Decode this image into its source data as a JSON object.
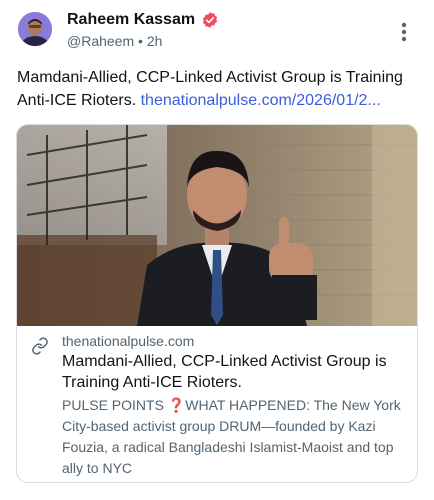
{
  "post": {
    "author_name": "Raheem Kassam",
    "handle": "@Raheem",
    "separator": "•",
    "time": "2h",
    "text_main": "Mamdani-Allied, CCP-Linked Activist Group is Training Anti-ICE Rioters.",
    "text_link": "thenationalpulse.com/2026/01/2..."
  },
  "card": {
    "domain": "thenationalpulse.com",
    "title": "Mamdani-Allied, CCP-Linked Activist Group is Training Anti-ICE Rioters.",
    "description": "PULSE POINTS ❓WHAT HAPPENED: The New York City-based activist group DRUM—founded by Kazi Fouzia, a radical Bangladeshi Islamist-Maoist and top ally to NYC"
  },
  "icons": {
    "verified": "verified-badge-icon",
    "more": "more-vertical-icon",
    "link": "link-icon"
  },
  "colors": {
    "verified_badge": "#f04a5c",
    "link": "#3a5dd9",
    "secondary_text": "#536471",
    "card_border": "#d9dde1"
  }
}
